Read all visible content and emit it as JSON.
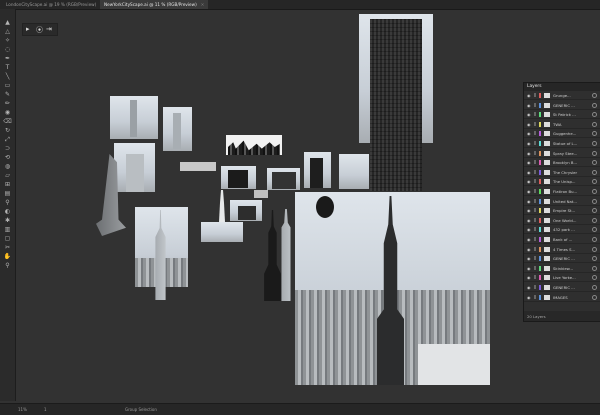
{
  "tabs": [
    {
      "label": "LondonCityScape.ai @ 19 % (RGB/Preview)",
      "active": false
    },
    {
      "label": "NewYorkCityScape.ai @ 11 % (RGB/Preview)",
      "active": true
    }
  ],
  "tools": [
    "arrow",
    "direct-select",
    "magic-wand",
    "lasso",
    "pen",
    "type",
    "line",
    "rectangle",
    "paintbrush",
    "pencil",
    "blob-brush",
    "eraser",
    "rotate",
    "scale",
    "width",
    "free-transform",
    "shape-builder",
    "perspective",
    "mesh",
    "gradient",
    "eyedropper",
    "blend",
    "symbol-sprayer",
    "graph",
    "artboard",
    "slice",
    "hand",
    "zoom"
  ],
  "layers_panel": {
    "title": "Layers",
    "footer": "20 Layers",
    "items": [
      "Grunge...",
      "GENERIC ...",
      "St Patrick ...",
      "TWA",
      "Guggenhe...",
      "Statue of L...",
      "Spray Stee...",
      "Brooklyn B...",
      "The Chrysler",
      "The Unisp...",
      "Flatiron Bu...",
      "United Nat...",
      "Empire St...",
      "One World...",
      "432 park ...",
      "Bank of ...",
      "4 Times S...",
      "GENERIC ...",
      "Skinkiew...",
      "Live Yorke...",
      "GENERIC ...",
      "IMAGES"
    ],
    "colors": [
      "#d95b5b",
      "#5b8fd9",
      "#5bd97a",
      "#d9d35b",
      "#b35bd9",
      "#5bd9d3",
      "#d9905b",
      "#d95bb0",
      "#7a5bd9",
      "#d95b5b",
      "#5bd95b",
      "#5b8fd9",
      "#d9d35b",
      "#d95b5b",
      "#5bd9d3",
      "#b35bd9",
      "#d9905b",
      "#5b8fd9",
      "#5bd97a",
      "#d95bb0",
      "#7a5bd9",
      "#5b8fd9"
    ]
  },
  "status": {
    "zoom": "11%",
    "artboard": "1",
    "selection": "Group Selection"
  }
}
